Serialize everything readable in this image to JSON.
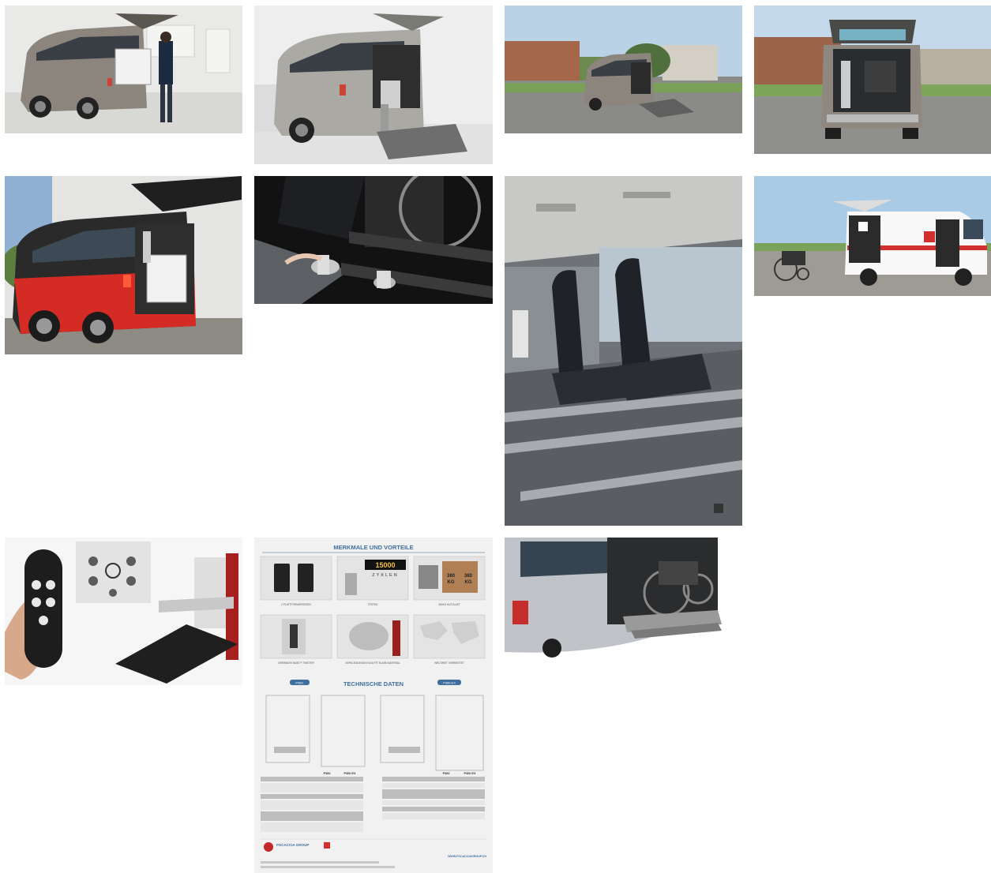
{
  "gallery": {
    "photos": [
      {
        "id": "p1",
        "subject": "van-showroom-lift"
      },
      {
        "id": "p2",
        "subject": "van-rear-platform-studio"
      },
      {
        "id": "p3",
        "subject": "van-outdoor-platform"
      },
      {
        "id": "p4",
        "subject": "van-rear-open-outdoor"
      },
      {
        "id": "p5",
        "subject": "red-black-van-lift"
      },
      {
        "id": "p6",
        "subject": "wheelchair-floor-anchor"
      },
      {
        "id": "p7",
        "subject": "van-interior-seats-rails"
      },
      {
        "id": "p8",
        "subject": "ambulance-van-wheelchair"
      },
      {
        "id": "p9",
        "subject": "remote-control-lift-product"
      },
      {
        "id": "p10",
        "subject": "product-brochure"
      },
      {
        "id": "p11",
        "subject": "side-door-wheelchair-platform"
      }
    ]
  },
  "brochure": {
    "header": "MERKMALE UND VORTEILE",
    "tech_header": "TECHNISCHE DATEN",
    "counter": "15000",
    "counter_unit": "ZYKLEN",
    "weight_1": "360",
    "weight_2": "360",
    "weight_unit": "KG",
    "feature_captions": [
      "2 PLATTFORMGRÖSSEN",
      "TESTED",
      "360KG NUTZLAST",
      "DREHBARE BASE P-TWISTER",
      "VERKLEIDUNGEN SLIM-FIT IN ABS-MATERIAL",
      "WELTWEIT VERBREITET"
    ],
    "model_1": "P360",
    "model_2": "P360 EX",
    "brand": "FOCACCIA GROUP",
    "website": "WWW.FOCACCIAGROUP.CH"
  },
  "colors": {
    "brochure_blue": "#3f6f9e",
    "van_red": "#d42b25",
    "van_silver": "#9ca3a8",
    "sky": "#c9dceb"
  }
}
